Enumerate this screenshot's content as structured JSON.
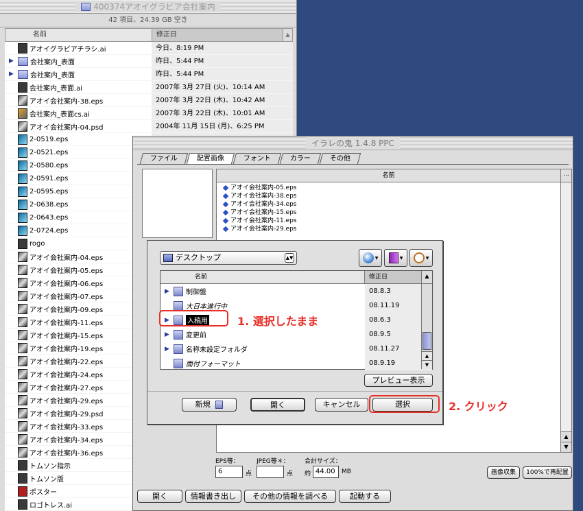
{
  "finder": {
    "title": "400374アオイグラビア会社案内",
    "info": "42 項目、24.39 GB 空き",
    "col_name": "名前",
    "col_date": "修正日",
    "rows": [
      {
        "name": "アオイグラビアチラシ.ai",
        "date": "今日、8:19 PM",
        "icon": "ai",
        "folder": false
      },
      {
        "name": "会社案内_表面",
        "date": "昨日、5:44 PM",
        "icon": "folder",
        "folder": true
      },
      {
        "name": "会社案内_表面",
        "date": "昨日、5:44 PM",
        "icon": "folder",
        "folder": true
      },
      {
        "name": "会社案内_表面.ai",
        "date": "2007年 3月 27日 (火)、10:14 AM",
        "icon": "ai",
        "folder": false
      },
      {
        "name": "アオイ会社案内-38.eps",
        "date": "2007年 3月 22日 (木)、10:42 AM",
        "icon": "img",
        "folder": false
      },
      {
        "name": "会社案内_表面cs.ai",
        "date": "2007年 3月 22日 (木)、10:01 AM",
        "icon": "cs",
        "folder": false
      },
      {
        "name": "アオイ会社案内-04.psd",
        "date": "2004年 11月 15日 (月)、6:25 PM",
        "icon": "img",
        "folder": false
      },
      {
        "name": "2-0519.eps",
        "date": "",
        "icon": "eps2",
        "folder": false
      },
      {
        "name": "2-0521.eps",
        "date": "",
        "icon": "eps2",
        "folder": false
      },
      {
        "name": "2-0580.eps",
        "date": "",
        "icon": "eps2",
        "folder": false
      },
      {
        "name": "2-0591.eps",
        "date": "",
        "icon": "eps2",
        "folder": false
      },
      {
        "name": "2-0595.eps",
        "date": "",
        "icon": "eps2",
        "folder": false
      },
      {
        "name": "2-0638.eps",
        "date": "",
        "icon": "eps2",
        "folder": false
      },
      {
        "name": "2-0643.eps",
        "date": "",
        "icon": "eps2",
        "folder": false
      },
      {
        "name": "2-0724.eps",
        "date": "",
        "icon": "eps2",
        "folder": false
      },
      {
        "name": "rogo",
        "date": "",
        "icon": "ai",
        "folder": false
      },
      {
        "name": "アオイ会社案内-04.eps",
        "date": "",
        "icon": "img",
        "folder": false
      },
      {
        "name": "アオイ会社案内-05.eps",
        "date": "",
        "icon": "img",
        "folder": false
      },
      {
        "name": "アオイ会社案内-06.eps",
        "date": "",
        "icon": "img",
        "folder": false
      },
      {
        "name": "アオイ会社案内-07.eps",
        "date": "",
        "icon": "img",
        "folder": false
      },
      {
        "name": "アオイ会社案内-09.eps",
        "date": "",
        "icon": "img",
        "folder": false
      },
      {
        "name": "アオイ会社案内-11.eps",
        "date": "",
        "icon": "img",
        "folder": false
      },
      {
        "name": "アオイ会社案内-15.eps",
        "date": "",
        "icon": "img",
        "folder": false
      },
      {
        "name": "アオイ会社案内-19.eps",
        "date": "",
        "icon": "img",
        "folder": false
      },
      {
        "name": "アオイ会社案内-22.eps",
        "date": "",
        "icon": "img",
        "folder": false
      },
      {
        "name": "アオイ会社案内-24.eps",
        "date": "",
        "icon": "img",
        "folder": false
      },
      {
        "name": "アオイ会社案内-27.eps",
        "date": "",
        "icon": "img",
        "folder": false
      },
      {
        "name": "アオイ会社案内-29.eps",
        "date": "",
        "icon": "img",
        "folder": false
      },
      {
        "name": "アオイ会社案内-29.psd",
        "date": "",
        "icon": "img",
        "folder": false
      },
      {
        "name": "アオイ会社案内-33.eps",
        "date": "",
        "icon": "img",
        "folder": false
      },
      {
        "name": "アオイ会社案内-34.eps",
        "date": "",
        "icon": "img",
        "folder": false
      },
      {
        "name": "アオイ会社案内-36.eps",
        "date": "",
        "icon": "img",
        "folder": false
      },
      {
        "name": "トムソン指示",
        "date": "",
        "icon": "ai",
        "folder": false
      },
      {
        "name": "トムソン版",
        "date": "",
        "icon": "ai",
        "folder": false
      },
      {
        "name": "ポスター",
        "date": "",
        "icon": "red",
        "folder": false
      },
      {
        "name": "ロゴトレス.ai",
        "date": "",
        "icon": "ai",
        "folder": false
      }
    ]
  },
  "illa": {
    "title": "イラレの鬼 1.4.8 PPC",
    "tabs": [
      "ファイル",
      "配置画像",
      "フォント",
      "カラー",
      "その他"
    ],
    "active_tab": 1,
    "list_header": "名前",
    "list_more": "...",
    "files": [
      "アオイ会社案内-05.eps",
      "アオイ会社案内-38.eps",
      "アオイ会社案内-34.eps",
      "アオイ会社案内-15.eps",
      "アオイ会社案内-11.eps",
      "アオイ会社案内-29.eps"
    ],
    "eps_label": "EPS等：",
    "eps_value": "6",
    "eps_unit": "点",
    "jpeg_label": "JPEG等＊：",
    "jpeg_value": "",
    "jpeg_unit": "点",
    "total_label": "合計サイズ：",
    "total_prefix": "約",
    "total_value": "44.00",
    "total_unit": "MB",
    "collect_btn": "画像収集",
    "relink_btn": "100%で再配置",
    "bottom_buttons": [
      "開く",
      "情報書き出し",
      "その他の情報を調べる",
      "起動する"
    ]
  },
  "dialog": {
    "location": "デスクトップ",
    "col_name": "名前",
    "col_date": "修正日",
    "rows": [
      {
        "name": "制御盤",
        "date": "08.8.3",
        "tri": true,
        "alias": false,
        "selected": false
      },
      {
        "name": "大日本進行中",
        "date": "08.11.19",
        "tri": false,
        "alias": true,
        "selected": false
      },
      {
        "name": "入稿用",
        "date": "08.6.3",
        "tri": true,
        "alias": false,
        "selected": true
      },
      {
        "name": "変更前",
        "date": "08.9.5",
        "tri": true,
        "alias": false,
        "selected": false
      },
      {
        "name": "名称未設定フォルダ",
        "date": "08.11.27",
        "tri": true,
        "alias": false,
        "selected": false
      },
      {
        "name": "面付フォーマット",
        "date": "08.9.19",
        "tri": false,
        "alias": true,
        "selected": false
      }
    ],
    "preview_btn": "プレビュー表示",
    "new_btn": "新規",
    "open_btn": "開く",
    "cancel_btn": "キャンセル",
    "select_btn": "選択"
  },
  "annotations": {
    "step1": "1. 選択したまま",
    "step2": "2. クリック",
    "color": "#e8302a"
  }
}
